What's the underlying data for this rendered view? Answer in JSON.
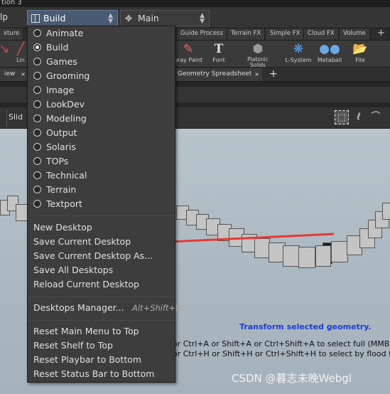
{
  "window_title": "tion 3",
  "menubar": {
    "help_label": "lp",
    "desktop_selector": "Build",
    "pane_selector": "Main"
  },
  "shelf_tabs": [
    "xture",
    "Guide Process",
    "Terrain FX",
    "Simple FX",
    "Cloud FX",
    "Volume"
  ],
  "shelf_tools": [
    {
      "label": "Lin",
      "icon": "line-icon"
    },
    {
      "label": "pray Paint",
      "icon": "spray-paint-icon"
    },
    {
      "label": "Font",
      "icon": "font-icon"
    },
    {
      "label": "Platonic Solids",
      "icon": "platonic-solids-icon"
    },
    {
      "label": "L-System",
      "icon": "l-system-icon"
    },
    {
      "label": "Metaball",
      "icon": "metaball-icon"
    },
    {
      "label": "File",
      "icon": "file-icon"
    }
  ],
  "pane_tabs": {
    "left": "iew",
    "right": "Geometry Spreadsheet"
  },
  "viewport_toolbar": {
    "slide_label": "Slid"
  },
  "desktops": [
    {
      "label": "Animate",
      "selected": false
    },
    {
      "label": "Build",
      "selected": true
    },
    {
      "label": "Games",
      "selected": false
    },
    {
      "label": "Grooming",
      "selected": false
    },
    {
      "label": "Image",
      "selected": false
    },
    {
      "label": "LookDev",
      "selected": false
    },
    {
      "label": "Modeling",
      "selected": false
    },
    {
      "label": "Output",
      "selected": false
    },
    {
      "label": "Solaris",
      "selected": false
    },
    {
      "label": "TOPs",
      "selected": false
    },
    {
      "label": "Technical",
      "selected": false
    },
    {
      "label": "Terrain",
      "selected": false
    },
    {
      "label": "Textport",
      "selected": false
    }
  ],
  "desktop_actions": [
    "New Desktop",
    "Save Current Desktop",
    "Save Current Desktop As...",
    "Save All Desktops",
    "Reload Current Desktop"
  ],
  "desktops_manager": {
    "label": "Desktops Manager...",
    "shortcut": "Alt+Shift+D"
  },
  "reset_actions": [
    "Reset Main Menu to Top",
    "Reset Shelf to Top",
    "Reset Playbar to Bottom",
    "Reset Status Bar to Bottom"
  ],
  "viewport_hints": {
    "title": "Transform selected geometry.",
    "line1": "or Ctrl+A or Shift+A or Ctrl+Shift+A to select full (MMB) or parti",
    "line2": "or Ctrl+H or Shift+H or Ctrl+Shift+H to select by flood fill."
  },
  "watermark": "CSDN @暮志未晚Webgl",
  "colors": {
    "selected_desktop_bg": "#4a5a72",
    "annotation_arrow": "#e53935",
    "hint_title": "#1f3cd4"
  }
}
